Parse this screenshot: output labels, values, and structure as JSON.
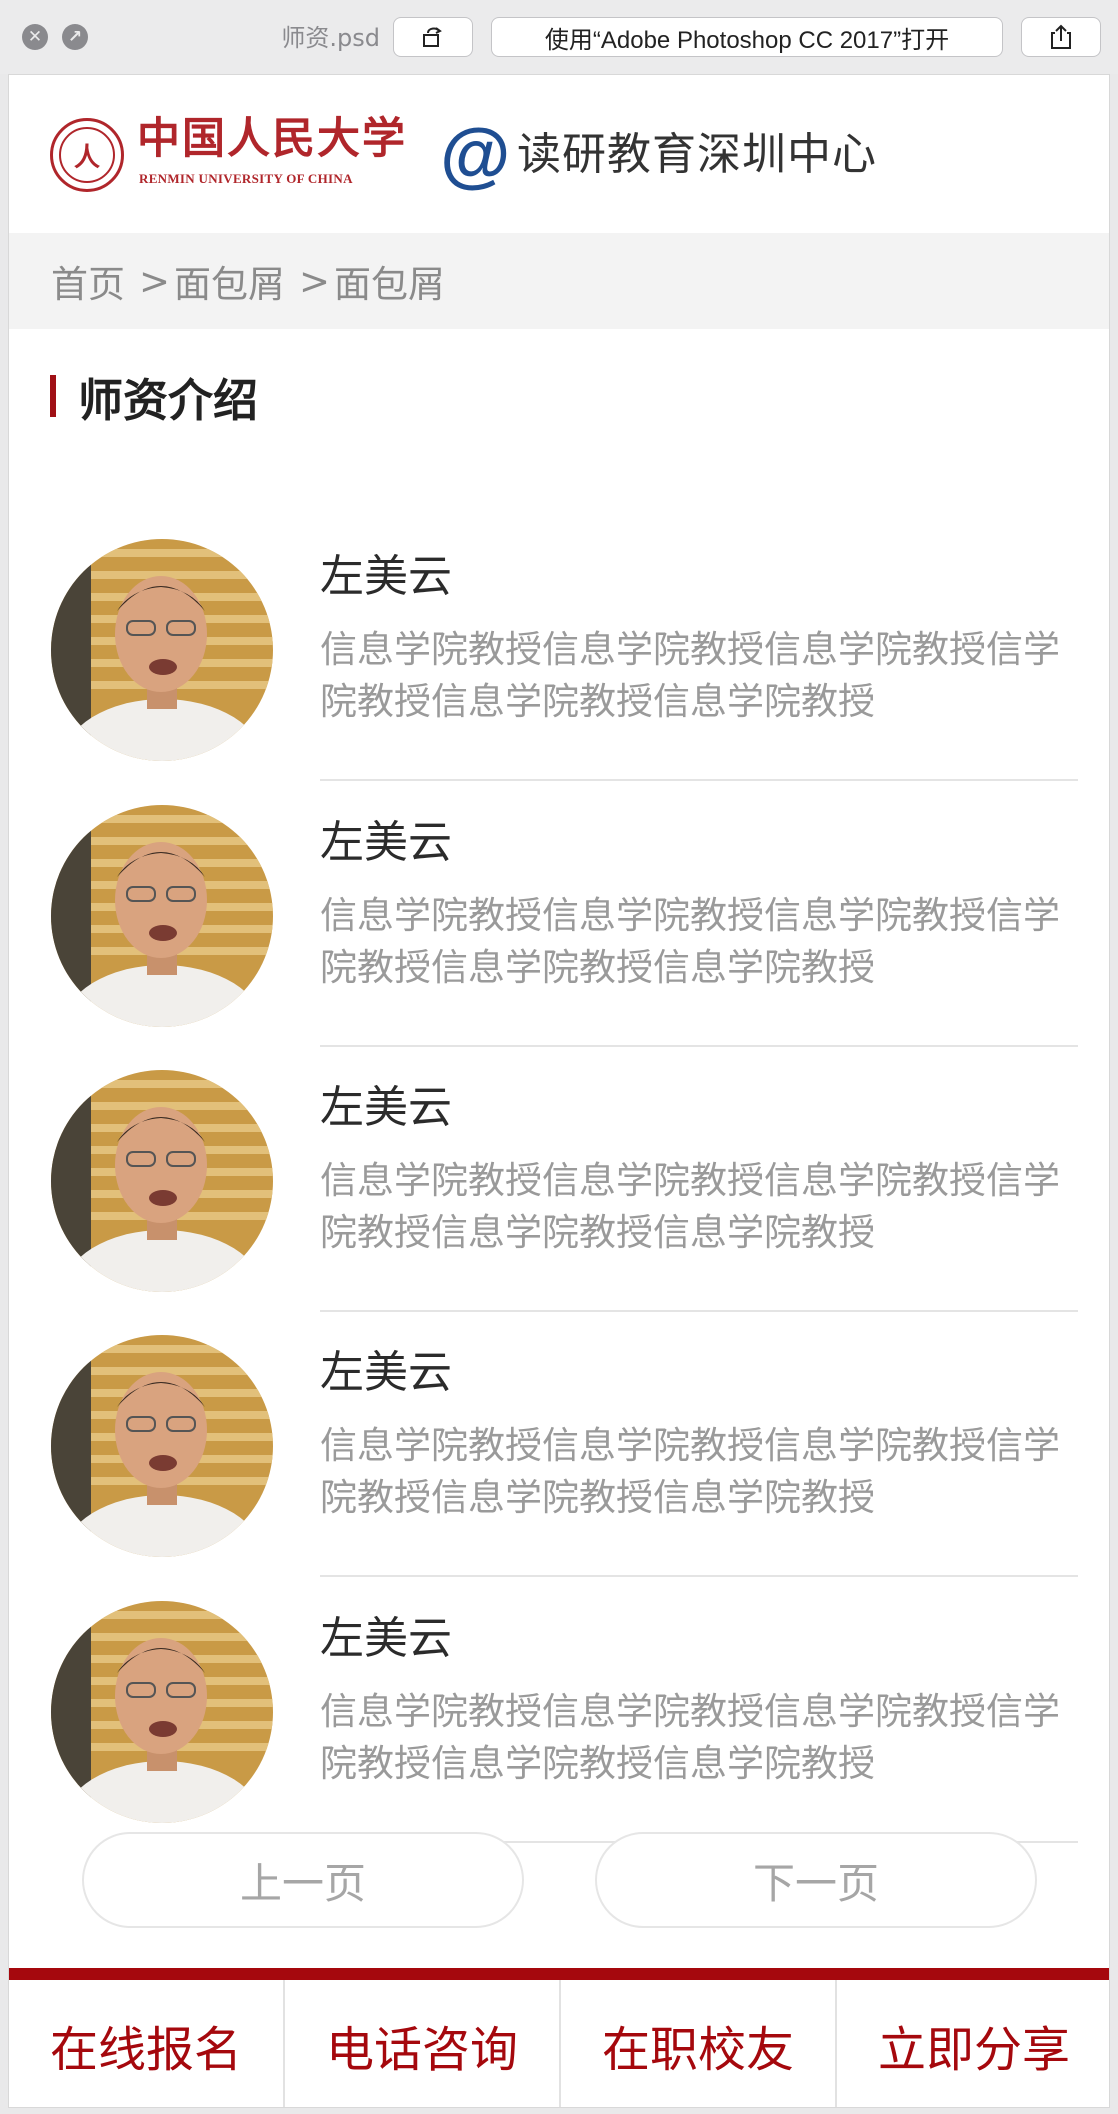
{
  "quicklook": {
    "filename": "师资.psd",
    "open_with_label": "使用“Adobe Photoshop CC 2017”打开"
  },
  "header": {
    "university_cn": "中国人民大学",
    "university_en": "RENMIN UNIVERSITY OF CHINA",
    "center_name": "读研教育深圳中心"
  },
  "breadcrumb": {
    "items": [
      "首页",
      "面包屑",
      "面包屑"
    ],
    "separator": ">"
  },
  "section": {
    "title": "师资介绍"
  },
  "teachers": [
    {
      "name": "左美云",
      "description": "信息学院教授信息学院教授信息学院教授信学院教授信息学院教授信息学院教授"
    },
    {
      "name": "左美云",
      "description": "信息学院教授信息学院教授信息学院教授信学院教授信息学院教授信息学院教授"
    },
    {
      "name": "左美云",
      "description": "信息学院教授信息学院教授信息学院教授信学院教授信息学院教授信息学院教授"
    },
    {
      "name": "左美云",
      "description": "信息学院教授信息学院教授信息学院教授信学院教授信息学院教授信息学院教授"
    },
    {
      "name": "左美云",
      "description": "信息学院教授信息学院教授信息学院教授信学院教授信息学院教授信息学院教授"
    }
  ],
  "pager": {
    "prev_label": "上一页",
    "next_label": "下一页"
  },
  "bottom_nav": {
    "items": [
      "在线报名",
      "电话咨询",
      "在职校友",
      "立即分享"
    ]
  },
  "colors": {
    "brand_red": "#a5080d",
    "logo_blue": "#1f4e92"
  }
}
